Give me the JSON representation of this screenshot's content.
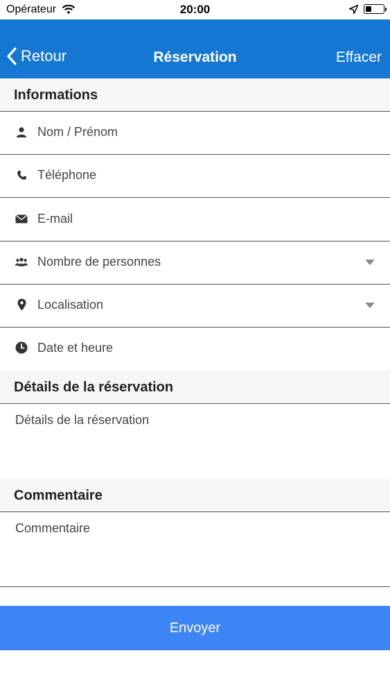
{
  "status_bar": {
    "carrier": "Opérateur",
    "time": "20:00",
    "battery_level": 0.35
  },
  "nav": {
    "back_label": "Retour",
    "title": "Réservation",
    "clear_label": "Effacer"
  },
  "sections": {
    "informations": "Informations",
    "details": "Détails de la réservation",
    "commentaire": "Commentaire"
  },
  "fields": {
    "name": {
      "placeholder": "Nom / Prénom",
      "icon": "person-icon"
    },
    "phone": {
      "placeholder": "Téléphone",
      "icon": "phone-icon"
    },
    "email": {
      "placeholder": "E-mail",
      "icon": "envelope-icon"
    },
    "people": {
      "placeholder": "Nombre de personnes",
      "icon": "group-icon"
    },
    "location": {
      "placeholder": "Localisation",
      "icon": "map-pin-icon"
    },
    "datetime": {
      "placeholder": "Date et heure",
      "icon": "clock-icon"
    },
    "details": {
      "placeholder": "Détails de la réservation"
    },
    "comment": {
      "placeholder": "Commentaire"
    }
  },
  "submit_label": "Envoyer",
  "colors": {
    "navbar": "#1577d2",
    "submit": "#3d84f5",
    "section_bg": "#f6f6f6"
  }
}
